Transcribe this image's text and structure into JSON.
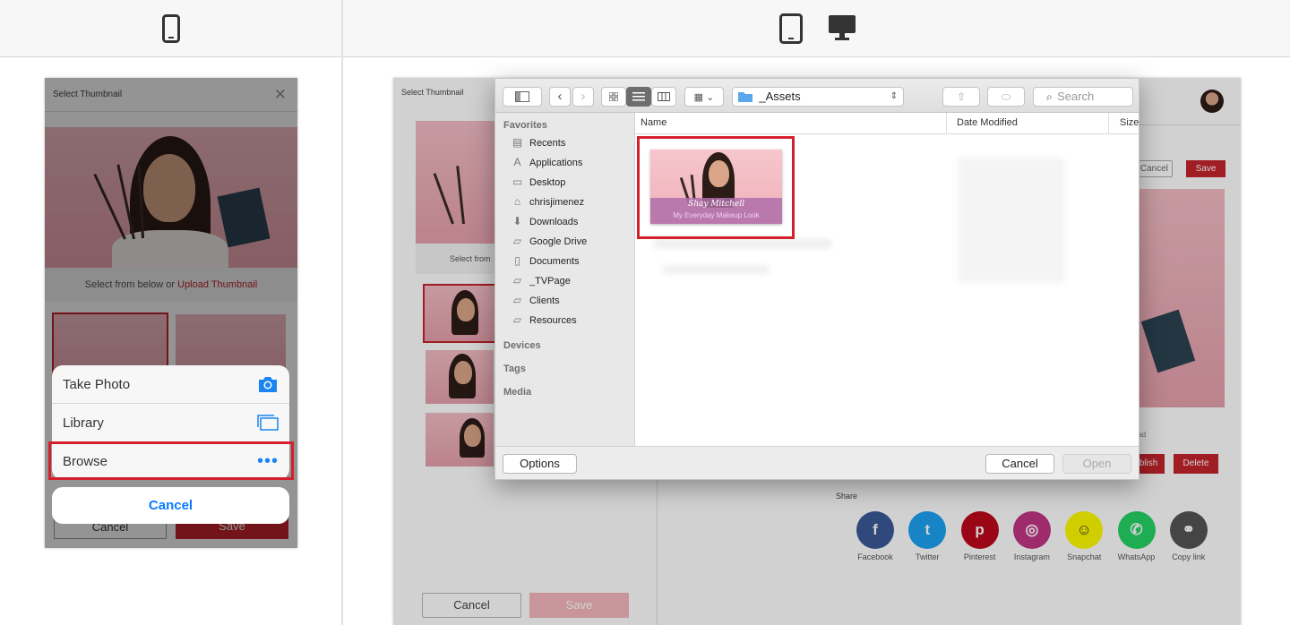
{
  "device_icons": [
    "phone-icon",
    "tablet-icon",
    "desktop-icon"
  ],
  "phone": {
    "title": "Select Thumbnail",
    "select_prefix": "Select from below or ",
    "upload_link": "Upload Thumbnail",
    "cancel": "Cancel",
    "save": "Save",
    "sheet": {
      "take_photo": "Take Photo",
      "library": "Library",
      "browse": "Browse",
      "cancel": "Cancel"
    }
  },
  "desktop": {
    "title": "Select Thumbnail",
    "select_text": "Select from",
    "cancel": "Cancel",
    "save": "Save",
    "right_cancel": "Cancel",
    "right_save": "Save",
    "publish": "blish",
    "delete": "Delete",
    "upload_partial": "load",
    "share_title": "Share",
    "share": [
      {
        "label": "Facebook",
        "icon": "facebook-icon",
        "color": "#3b5998",
        "glyph": "f"
      },
      {
        "label": "Twitter",
        "icon": "twitter-icon",
        "color": "#1da1f2",
        "glyph": "t"
      },
      {
        "label": "Pinterest",
        "icon": "pinterest-icon",
        "color": "#bd081c",
        "glyph": "p"
      },
      {
        "label": "Instagram",
        "icon": "instagram-icon",
        "color": "#c13584",
        "glyph": "◎"
      },
      {
        "label": "Snapchat",
        "icon": "snapchat-icon",
        "color": "#fffc00",
        "glyph": "☺"
      },
      {
        "label": "WhatsApp",
        "icon": "whatsapp-icon",
        "color": "#25d366",
        "glyph": "✆"
      },
      {
        "label": "Copy link",
        "icon": "link-icon",
        "color": "#555555",
        "glyph": "⚭"
      }
    ]
  },
  "dialog": {
    "folder": "_Assets",
    "search_placeholder": "Search",
    "sidebar": {
      "favorites": "Favorites",
      "items": [
        {
          "label": "Recents",
          "icon": "recents-icon",
          "glyph": "▤"
        },
        {
          "label": "Applications",
          "icon": "applications-icon",
          "glyph": "A"
        },
        {
          "label": "Desktop",
          "icon": "desktop-folder-icon",
          "glyph": "▭"
        },
        {
          "label": "chrisjimenez",
          "icon": "home-icon",
          "glyph": "⌂"
        },
        {
          "label": "Downloads",
          "icon": "downloads-icon",
          "glyph": "⬇"
        },
        {
          "label": "Google Drive",
          "icon": "folder-icon",
          "glyph": "▱"
        },
        {
          "label": "Documents",
          "icon": "documents-icon",
          "glyph": "▯"
        },
        {
          "label": "_TVPage",
          "icon": "folder-icon",
          "glyph": "▱"
        },
        {
          "label": "Clients",
          "icon": "folder-icon",
          "glyph": "▱"
        },
        {
          "label": "Resources",
          "icon": "folder-icon",
          "glyph": "▱"
        }
      ],
      "devices": "Devices",
      "tags": "Tags",
      "media": "Media"
    },
    "columns": {
      "name": "Name",
      "date_modified": "Date Modified",
      "size": "Size"
    },
    "file": {
      "title_script": "Shay Mitchell",
      "subtitle": "My Everyday Makeup Look"
    },
    "options": "Options",
    "cancel": "Cancel",
    "open": "Open"
  },
  "colors": {
    "accent_red": "#c4242b",
    "highlight_red": "#d4202c",
    "ios_blue": "#0a7aff",
    "pink_bg": "#f1b9c0"
  }
}
